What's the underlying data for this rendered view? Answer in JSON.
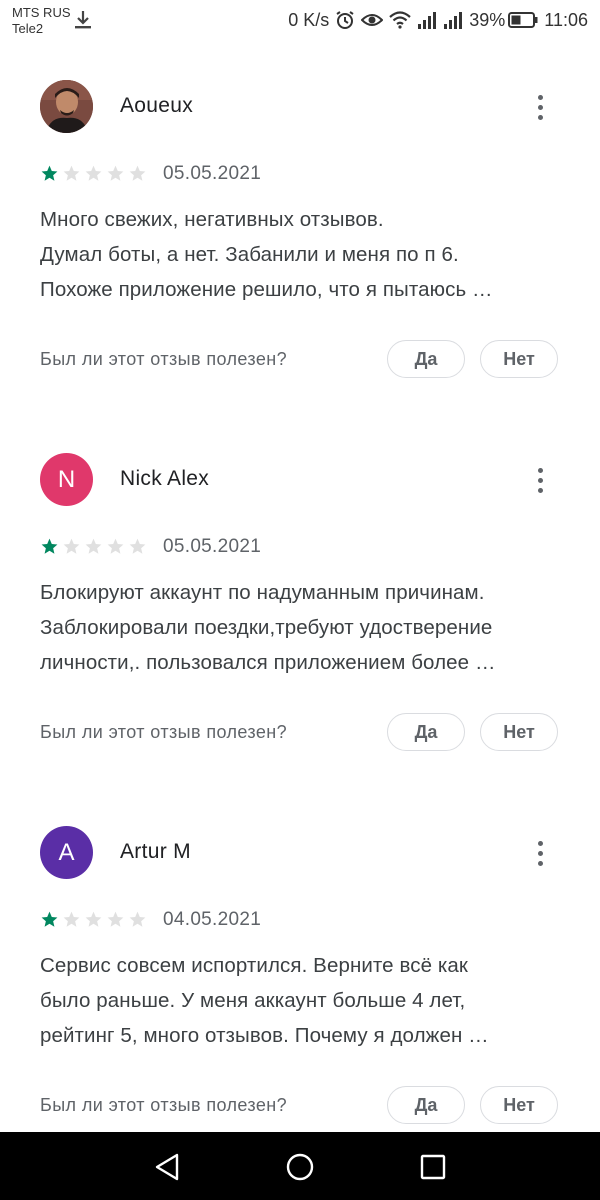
{
  "status_bar": {
    "carrier_1": "MTS RUS",
    "carrier_2": "Tele2",
    "net_speed": "0 K/s",
    "battery": "39%",
    "time": "11:06"
  },
  "colors": {
    "star_filled": "#01875f",
    "star_empty": "#e0e0e0",
    "avatar_nick": "#e0386b",
    "avatar_artur": "#5a2ea6"
  },
  "reviews": [
    {
      "author": "Aoueux",
      "avatar_type": "photo",
      "rating": 1,
      "date": "05.05.2021",
      "text_lines": [
        "Много свежих, негативных отзывов.",
        "Думал боты, а нет. Забанили и меня по п 6.",
        "Похоже приложение решило, что я пытаюсь …"
      ],
      "helpful_question": "Был ли этот отзыв полезен?",
      "yes_label": "Да",
      "no_label": "Нет"
    },
    {
      "author": "Nick Alex",
      "avatar_letter": "N",
      "rating": 1,
      "date": "05.05.2021",
      "text_lines": [
        "Блокируют аккаунт по надуманным причинам.",
        "Заблокировали поездки,требуют удостверение",
        "личности,. пользовался приложением более …"
      ],
      "helpful_question": "Был ли этот отзыв полезен?",
      "yes_label": "Да",
      "no_label": "Нет"
    },
    {
      "author": "Artur M",
      "avatar_letter": "A",
      "rating": 1,
      "date": "04.05.2021",
      "text_lines": [
        "Сервис совсем испортился. Верните всё как",
        "было раньше. У меня аккаунт больше 4 лет,",
        "рейтинг 5, много отзывов. Почему я должен …"
      ],
      "helpful_question": "Был ли этот отзыв полезен?",
      "yes_label": "Да",
      "no_label": "Нет"
    }
  ],
  "nav_icons": [
    "back-icon",
    "home-icon",
    "recents-icon"
  ]
}
